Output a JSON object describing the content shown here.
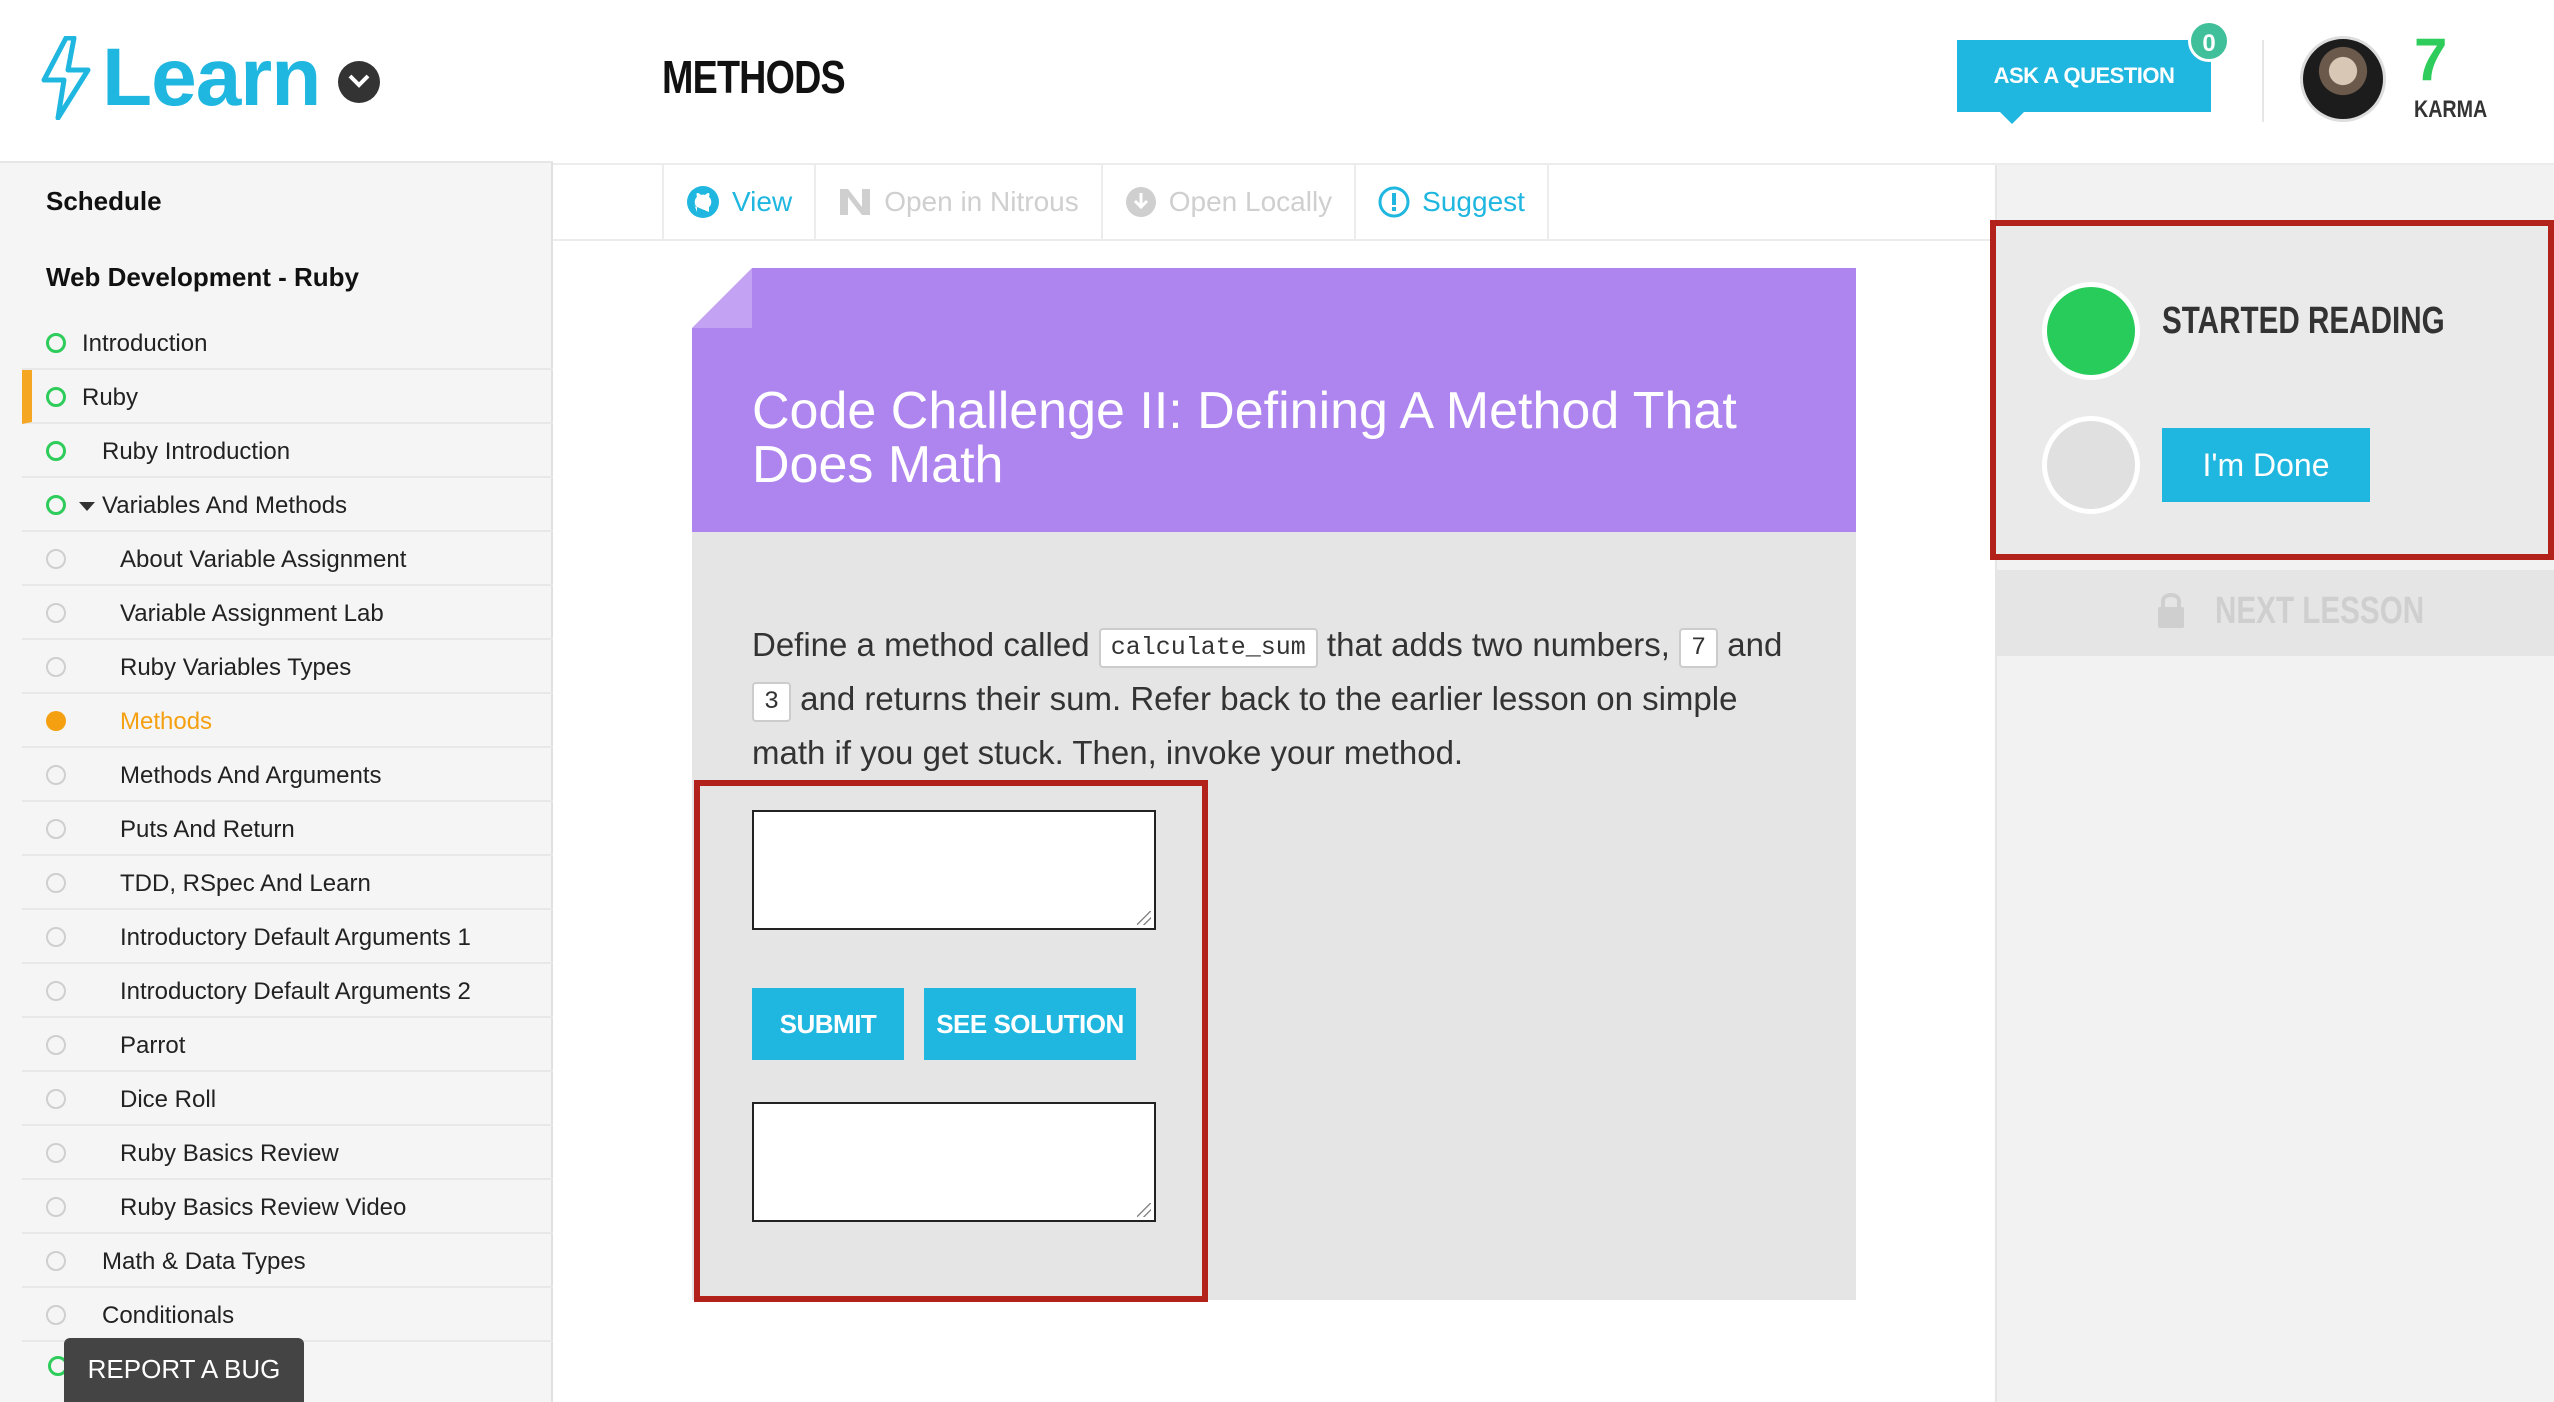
{
  "logo": {
    "text": "Learn"
  },
  "sidebar": {
    "schedule": "Schedule",
    "course": "Web Development - Ruby",
    "items": [
      {
        "label": "Introduction",
        "status": "green"
      },
      {
        "label": "Ruby",
        "status": "green"
      },
      {
        "label": "Ruby Introduction",
        "status": "green"
      },
      {
        "label": "Variables And Methods",
        "status": "green"
      },
      {
        "label": "About Variable Assignment",
        "status": "gray"
      },
      {
        "label": "Variable Assignment Lab",
        "status": "gray"
      },
      {
        "label": "Ruby Variables Types",
        "status": "gray"
      },
      {
        "label": "Methods",
        "status": "orange"
      },
      {
        "label": "Methods And Arguments",
        "status": "gray"
      },
      {
        "label": "Puts And Return",
        "status": "gray"
      },
      {
        "label": "TDD, RSpec And Learn",
        "status": "gray"
      },
      {
        "label": "Introductory Default Arguments 1",
        "status": "gray"
      },
      {
        "label": "Introductory Default Arguments 2",
        "status": "gray"
      },
      {
        "label": "Parrot",
        "status": "gray"
      },
      {
        "label": "Dice Roll",
        "status": "gray"
      },
      {
        "label": "Ruby Basics Review",
        "status": "gray"
      },
      {
        "label": "Ruby Basics Review Video",
        "status": "gray"
      },
      {
        "label": "Math & Data Types",
        "status": "gray"
      },
      {
        "label": "Conditionals",
        "status": "gray"
      }
    ],
    "report_bug": "REPORT A BUG"
  },
  "header": {
    "title": "METHODS",
    "ask_button": "ASK A QUESTION",
    "ask_count": "0",
    "karma_value": "7",
    "karma_label": "KARMA"
  },
  "toolbar": {
    "view": "View",
    "nitrous": "Open in Nitrous",
    "locally": "Open Locally",
    "suggest": "Suggest"
  },
  "lesson": {
    "title": "Code Challenge II: Defining A Method That Does Math",
    "desc_1": "Define a method called ",
    "code_1": "calculate_sum",
    "desc_2": " that adds two numbers, ",
    "code_2": "7",
    "desc_3": " and ",
    "code_3": "3",
    "desc_4": " and returns their sum. Refer back to the earlier lesson on simple math if you get stuck. Then, invoke your method.",
    "submit": "SUBMIT",
    "see_solution": "SEE SOLUTION",
    "code_input_value": "",
    "output_value": ""
  },
  "progress": {
    "started": "STARTED READING",
    "done_button": "I'm Done",
    "next_lesson": "NEXT LESSON"
  },
  "colors": {
    "accent": "#1fb7e0",
    "green": "#27cc5a",
    "orange": "#f5a011",
    "purple": "#ae84ef",
    "highlight_red": "#b3211b"
  }
}
